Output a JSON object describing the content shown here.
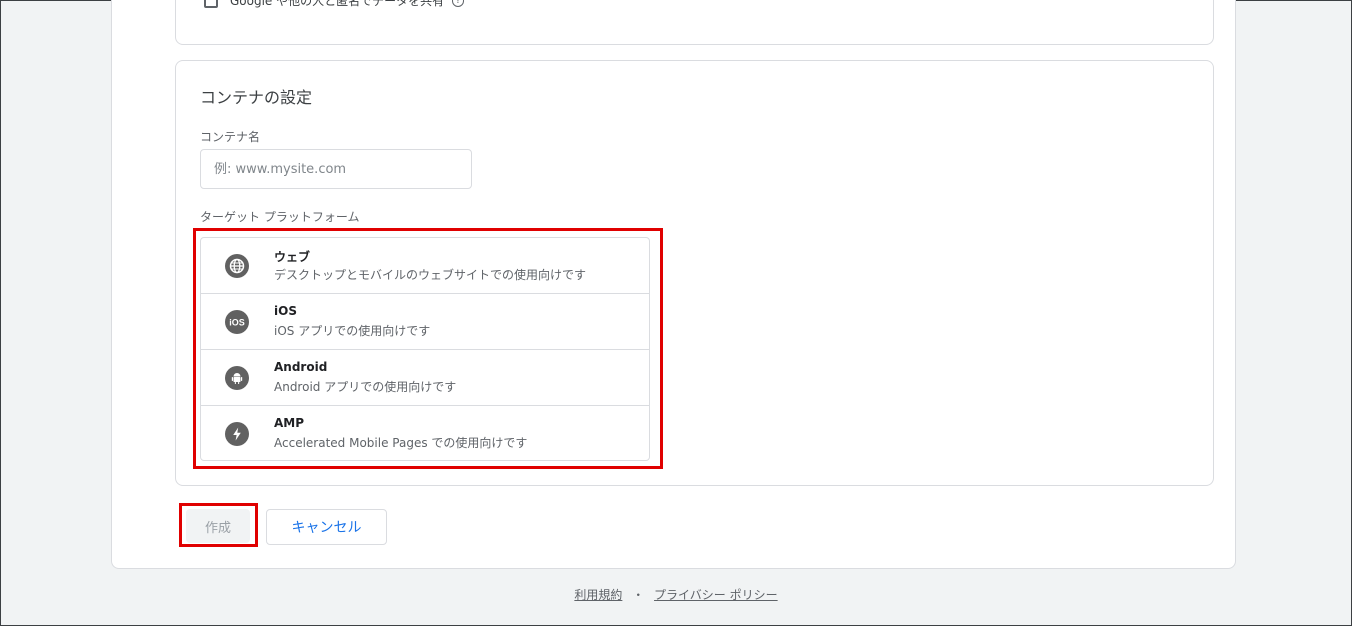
{
  "share": {
    "label": "Google や他の人と匿名でデータを共有"
  },
  "container": {
    "section_title": "コンテナの設定",
    "name_label": "コンテナ名",
    "name_placeholder": "例: www.mysite.com",
    "name_value": "",
    "platform_label": "ターゲット プラットフォーム",
    "platforms": [
      {
        "title": "ウェブ",
        "description": "デスクトップとモバイルのウェブサイトでの使用向けです",
        "icon": "globe-icon"
      },
      {
        "title": "iOS",
        "description": "iOS アプリでの使用向けです",
        "icon": "ios-icon"
      },
      {
        "title": "Android",
        "description": "Android アプリでの使用向けです",
        "icon": "android-icon"
      },
      {
        "title": "AMP",
        "description": "Accelerated Mobile Pages での使用向けです",
        "icon": "amp-lightning-icon"
      }
    ]
  },
  "actions": {
    "create_label": "作成",
    "cancel_label": "キャンセル"
  },
  "footer": {
    "terms_label": "利用規約",
    "separator": "・",
    "privacy_label": "プライバシー ポリシー"
  },
  "colors": {
    "highlight": "#e00000",
    "accent": "#1a73e8",
    "icon_bg": "#616161"
  }
}
